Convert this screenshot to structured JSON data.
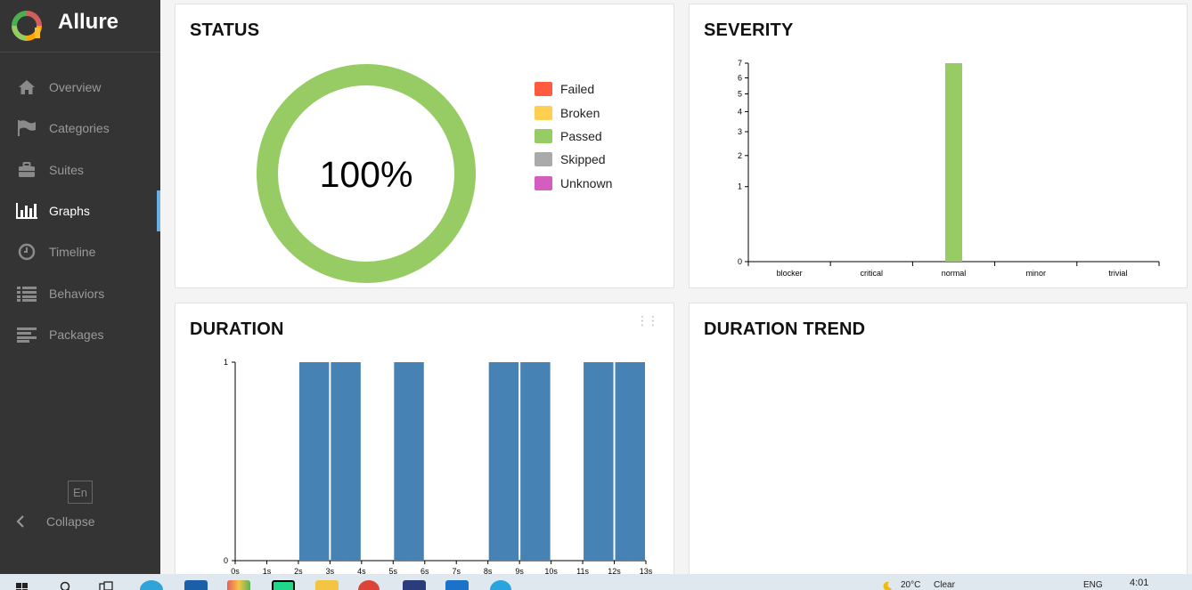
{
  "app": {
    "name": "Allure",
    "logo_icon": "allure-logo-icon"
  },
  "sidebar": {
    "items": [
      {
        "label": "Overview",
        "icon": "home-icon"
      },
      {
        "label": "Categories",
        "icon": "flag-icon"
      },
      {
        "label": "Suites",
        "icon": "briefcase-icon"
      },
      {
        "label": "Graphs",
        "icon": "bar-chart-icon",
        "active": true
      },
      {
        "label": "Timeline",
        "icon": "clock-icon"
      },
      {
        "label": "Behaviors",
        "icon": "list-icon"
      },
      {
        "label": "Packages",
        "icon": "align-left-icon"
      }
    ],
    "language": "En",
    "collapse_label": "Collapse"
  },
  "widgets": {
    "status": {
      "title": "STATUS",
      "percent_label": "100%",
      "legend": [
        {
          "label": "Failed",
          "color": "#fd5a3e"
        },
        {
          "label": "Broken",
          "color": "#ffd050"
        },
        {
          "label": "Passed",
          "color": "#97cc64"
        },
        {
          "label": "Skipped",
          "color": "#aaaaaa"
        },
        {
          "label": "Unknown",
          "color": "#d35ebe"
        }
      ]
    },
    "severity": {
      "title": "SEVERITY"
    },
    "duration": {
      "title": "DURATION"
    },
    "duration_trend": {
      "title": "DURATION TREND"
    }
  },
  "chart_data": [
    {
      "type": "pie",
      "title": "STATUS",
      "categories": [
        "Failed",
        "Broken",
        "Passed",
        "Skipped",
        "Unknown"
      ],
      "values": [
        0,
        0,
        100,
        0,
        0
      ],
      "center_label": "100%",
      "colors": [
        "#fd5a3e",
        "#ffd050",
        "#97cc64",
        "#aaaaaa",
        "#d35ebe"
      ],
      "legend": "right"
    },
    {
      "type": "bar",
      "title": "SEVERITY",
      "categories": [
        "blocker",
        "critical",
        "normal",
        "minor",
        "trivial"
      ],
      "values": [
        0,
        0,
        7,
        0,
        0
      ],
      "yticks": [
        0,
        1,
        2,
        3,
        4,
        5,
        6,
        7
      ],
      "ylim": [
        0,
        7
      ],
      "yscale": "sqrt",
      "color": "#97cc64"
    },
    {
      "type": "bar",
      "title": "DURATION",
      "x_ticks": [
        "0s",
        "1s",
        "2s",
        "3s",
        "4s",
        "5s",
        "6s",
        "7s",
        "8s",
        "9s",
        "10s",
        "11s",
        "12s",
        "13s"
      ],
      "bins": [
        [
          2,
          3
        ],
        [
          3,
          4
        ],
        [
          5,
          6
        ],
        [
          8,
          9
        ],
        [
          9,
          10
        ],
        [
          11,
          12
        ],
        [
          12,
          13
        ]
      ],
      "values": [
        1,
        1,
        1,
        1,
        1,
        1,
        1
      ],
      "yticks": [
        0,
        1
      ],
      "ylim": [
        0,
        1
      ],
      "xlim": [
        0,
        13
      ],
      "color": "#4682b4"
    }
  ],
  "taskbar": {
    "temperature": "20°C",
    "weather": "Clear",
    "language": "ENG",
    "time": "4:01",
    "app_icons": [
      "windows-icon",
      "search-icon",
      "task-view-icon",
      "edge-icon",
      "mail-icon",
      "paint-icon",
      "pycharm-icon",
      "file-explorer-icon",
      "chrome-icon",
      "notepad-icon",
      "outlook-icon",
      "telegram-icon"
    ]
  }
}
